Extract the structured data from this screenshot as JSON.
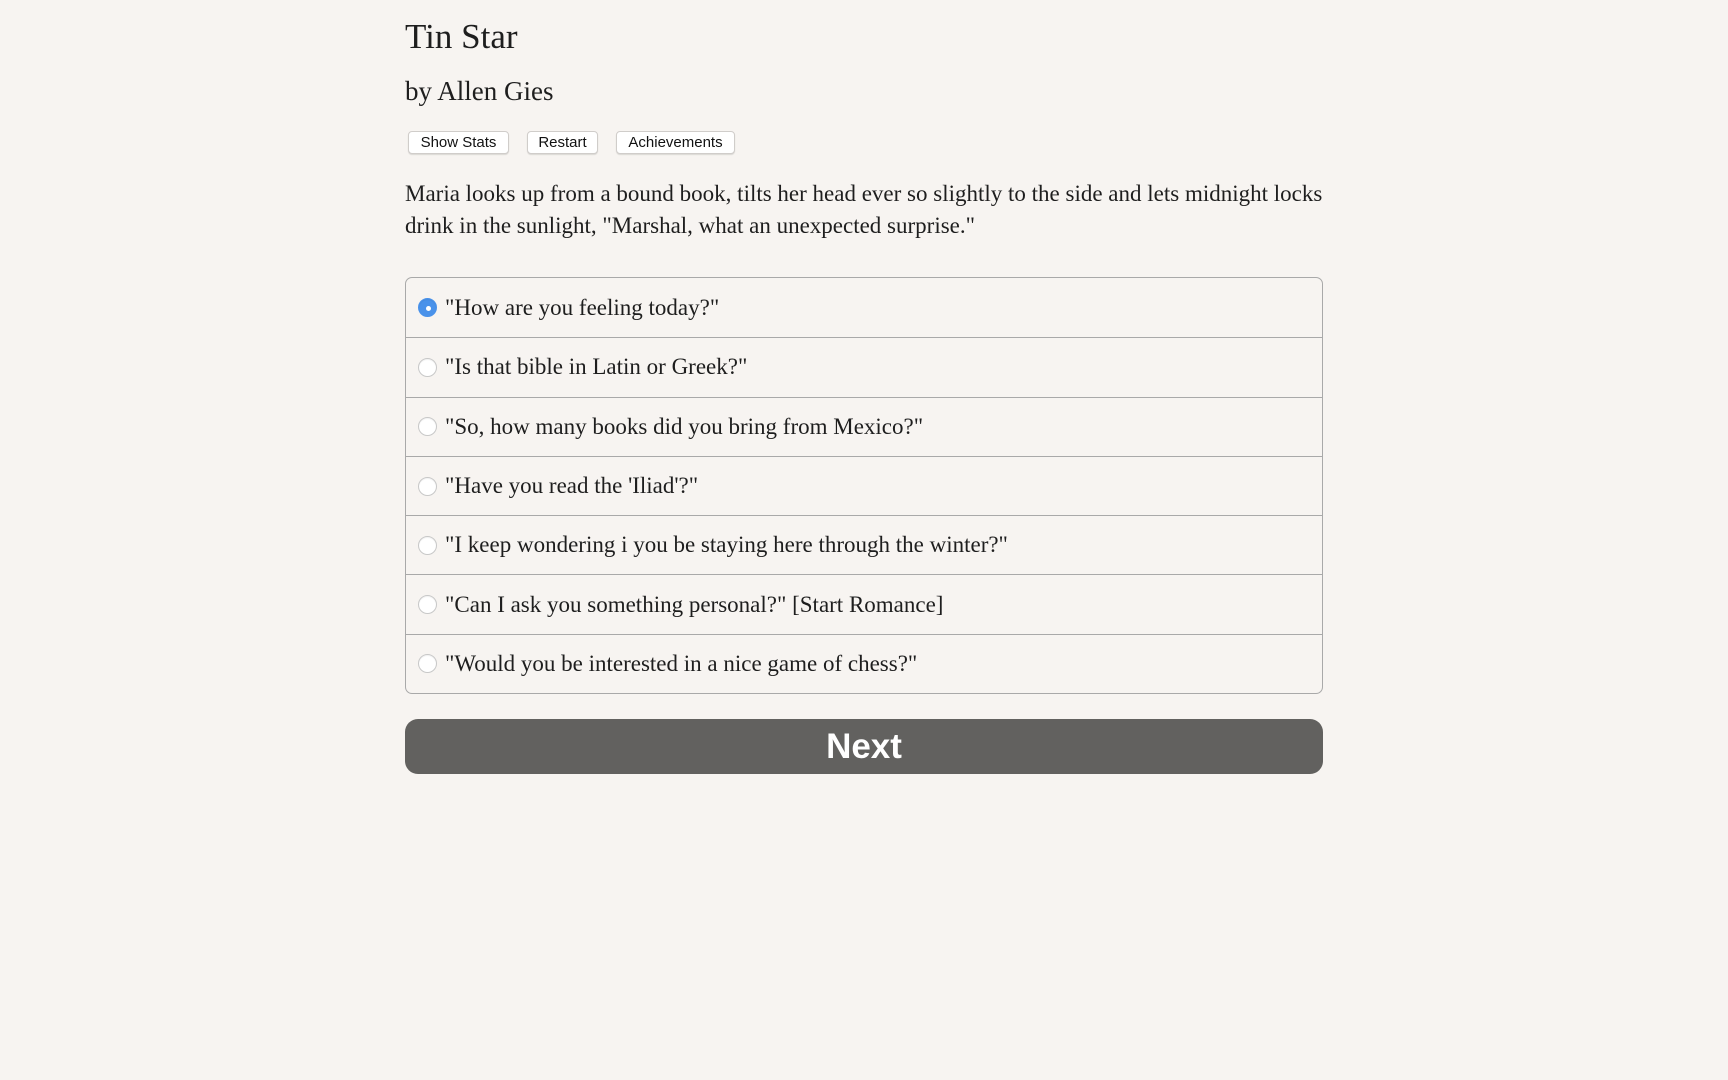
{
  "game": {
    "title": "Tin Star",
    "byline": "by Allen Gies"
  },
  "toolbar": {
    "show_stats_label": "Show Stats",
    "restart_label": "Restart",
    "achievements_label": "Achievements"
  },
  "story": {
    "text": "Maria looks up from a bound book, tilts her head ever so slightly to the side and lets midnight locks drink in the sunlight, \"Marshal, what an unexpected surprise.\""
  },
  "choices": {
    "selected_index": 0,
    "items": [
      {
        "label": "\"How are you feeling today?\"",
        "selected": true
      },
      {
        "label": "\"Is that bible in Latin or Greek?\"",
        "selected": false
      },
      {
        "label": "\"So, how many books did you bring from Mexico?\"",
        "selected": false
      },
      {
        "label": "\"Have you read the 'Iliad'?\"",
        "selected": false
      },
      {
        "label": "\"I keep wondering i you be staying here through the winter?\"",
        "selected": false
      },
      {
        "label": "\"Can I ask you something personal?\" [Start Romance]",
        "selected": false
      },
      {
        "label": "\"Would you be interested in a nice game of chess?\"",
        "selected": false
      }
    ]
  },
  "next": {
    "label": "Next"
  },
  "colors": {
    "background": "#f7f4f1",
    "radio_selected": "#4a92ea",
    "next_button": "#62615f"
  }
}
